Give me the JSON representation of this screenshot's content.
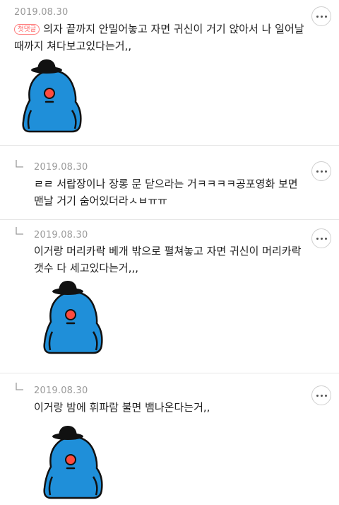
{
  "comments": [
    {
      "date": "2019.08.30",
      "badge": "첫댓글",
      "lines": [
        "의자 끝까지 안밀어놓고 자면 귀신이 거기 앉아서 나 일어날",
        "때까지 쳐다보고있다는거,,"
      ],
      "has_sticker": true
    },
    {
      "date": "2019.08.30",
      "lines": [
        "ㄹㄹ 서랍장이나 장롱 문 닫으라는 거ㅋㅋㅋㅋ공포영화 보면",
        "맨날 거기 숨어있더라ㅅㅂㅠㅠ"
      ],
      "has_sticker": false
    },
    {
      "date": "2019.08.30",
      "lines": [
        "이거랑 머리카락 베개 밖으로 펼쳐놓고 자면 귀신이 머리카락",
        "갯수 다 세고있다는거,,,"
      ],
      "has_sticker": true
    },
    {
      "date": "2019.08.30",
      "lines": [
        "이거랑 밤에 휘파람 불면 뱀나온다는거,,"
      ],
      "has_sticker": true
    }
  ],
  "colors": {
    "sticker_body": "#1f8fd9",
    "sticker_nose": "#ff4b3e",
    "badge": "#ff5a5a"
  },
  "icons": {
    "more": "more-dots-icon",
    "reply": "reply-arrow-icon"
  }
}
